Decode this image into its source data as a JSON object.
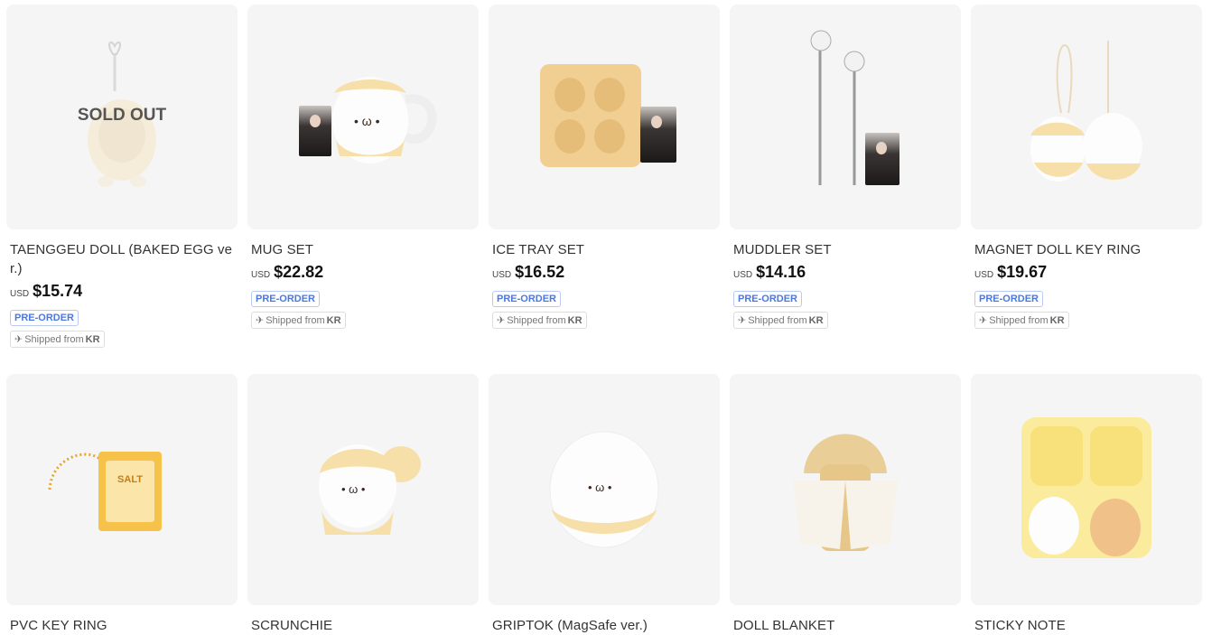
{
  "products_row1": [
    {
      "name": "TAENGGEU DOLL (BAKED EGG ver.)",
      "currency": "USD",
      "price": "$15.74",
      "badge": "PRE-ORDER",
      "shipped_prefix": "Shipped from",
      "shipped_country": "KR",
      "overlay": "SOLD OUT"
    },
    {
      "name": "MUG SET",
      "currency": "USD",
      "price": "$22.82",
      "badge": "PRE-ORDER",
      "shipped_prefix": "Shipped from",
      "shipped_country": "KR"
    },
    {
      "name": "ICE TRAY SET",
      "currency": "USD",
      "price": "$16.52",
      "badge": "PRE-ORDER",
      "shipped_prefix": "Shipped from",
      "shipped_country": "KR"
    },
    {
      "name": "MUDDLER SET",
      "currency": "USD",
      "price": "$14.16",
      "badge": "PRE-ORDER",
      "shipped_prefix": "Shipped from",
      "shipped_country": "KR"
    },
    {
      "name": "MAGNET DOLL KEY RING",
      "currency": "USD",
      "price": "$19.67",
      "badge": "PRE-ORDER",
      "shipped_prefix": "Shipped from",
      "shipped_country": "KR"
    }
  ],
  "products_row2": [
    {
      "name": "PVC KEY RING",
      "image_text": "SALT"
    },
    {
      "name": "SCRUNCHIE"
    },
    {
      "name": "GRIPTOK (MagSafe ver.)"
    },
    {
      "name": "DOLL BLANKET"
    },
    {
      "name": "STICKY NOTE"
    }
  ],
  "icons": {
    "shipped": "airplane-icon"
  },
  "colors": {
    "badge_blue": "#4a78e0",
    "card_bg": "#f5f5f5",
    "yolk": "#f6dfa8"
  }
}
